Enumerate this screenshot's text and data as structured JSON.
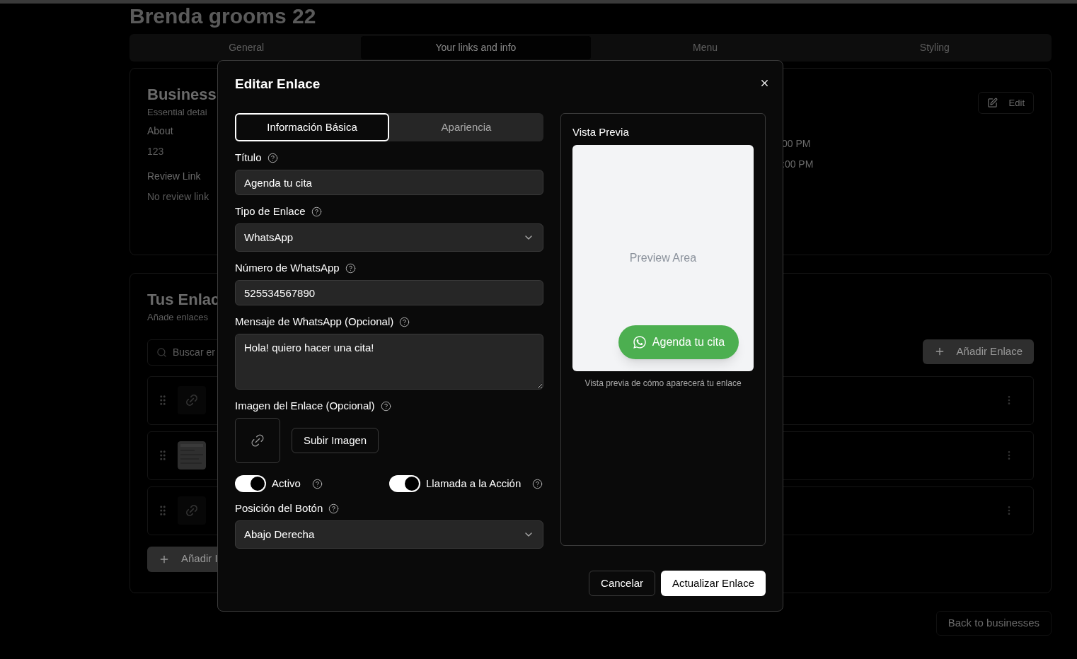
{
  "page": {
    "title": "Brenda grooms 22",
    "tabs": [
      {
        "label": "General",
        "selected": false
      },
      {
        "label": "Your links and info",
        "selected": true
      },
      {
        "label": "Menu",
        "selected": false
      },
      {
        "label": "Styling",
        "selected": false
      }
    ],
    "business_card": {
      "heading": "Business",
      "subtitle": "Essential detai",
      "fields": [
        {
          "label": "About",
          "value": "123"
        },
        {
          "label": "Review Link",
          "value": "No review link"
        }
      ],
      "hours": [
        "00 PM",
        ":00 PM"
      ],
      "edit_button": "Edit"
    },
    "links_card": {
      "heading": "Tus Enlac",
      "subtitle": "Añade enlaces",
      "search_placeholder": "Buscar er",
      "add_button": "Añadir Enlace",
      "rows": [
        {
          "kind": "link"
        },
        {
          "kind": "picture"
        },
        {
          "kind": "link"
        }
      ],
      "add_bottom": "Añadir I"
    },
    "back_button": "Back to businesses"
  },
  "dialog": {
    "title": "Editar Enlace",
    "tabs": [
      {
        "label": "Información Básica",
        "selected": true
      },
      {
        "label": "Apariencia",
        "selected": false
      }
    ],
    "fields": [
      {
        "kind": "input",
        "label": "Título",
        "value": "Agenda tu cita"
      },
      {
        "kind": "select",
        "label": "Tipo de Enlace",
        "value": "WhatsApp"
      },
      {
        "kind": "input",
        "label": "Número de WhatsApp",
        "value": "525534567890"
      },
      {
        "kind": "textarea",
        "label": "Mensaje de WhatsApp (Opcional)",
        "value": "Hola! quiero hacer una cita!"
      },
      {
        "label": "Imagen del Enlace (Opcional)",
        "button": "Subir Imagen"
      },
      {
        "kind": "toggles",
        "toggles": [
          {
            "label": "Activo",
            "on": true
          },
          {
            "label": "Llamada a la Acción",
            "on": true
          }
        ]
      },
      {
        "kind": "select",
        "label": "Posición del Botón",
        "value": "Abajo Derecha"
      }
    ],
    "preview": {
      "title": "Vista Previa",
      "placeholder": "Preview Area",
      "cta": "Agenda tu cita",
      "caption": "Vista previa de cómo aparecerá tu enlace"
    },
    "cancel_button": "Cancelar",
    "submit_button": "Actualizar Enlace"
  }
}
